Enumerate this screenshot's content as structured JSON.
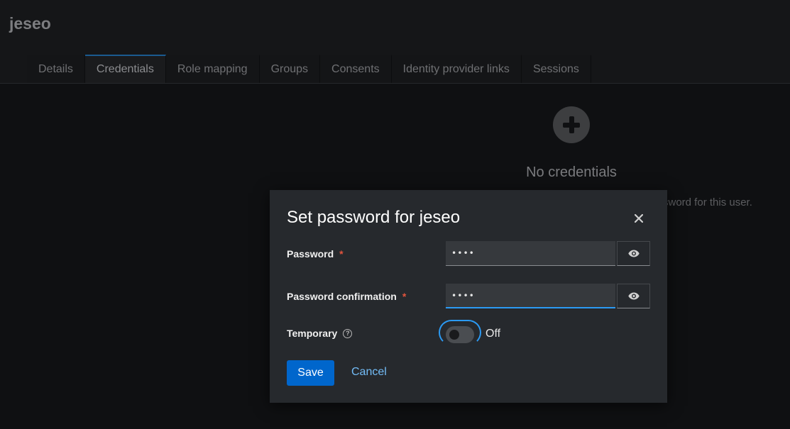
{
  "page": {
    "title": "jeseo",
    "tabs": [
      {
        "label": "Details"
      },
      {
        "label": "Credentials"
      },
      {
        "label": "Role mapping"
      },
      {
        "label": "Groups"
      },
      {
        "label": "Consents"
      },
      {
        "label": "Identity provider links"
      },
      {
        "label": "Sessions"
      }
    ],
    "active_tab": "Credentials",
    "empty_state": {
      "icon": "plus-circle-icon",
      "title": "No credentials",
      "body_fragment": "sword for this user."
    }
  },
  "modal": {
    "title": "Set password for jeseo",
    "close_icon": "close-icon",
    "password": {
      "label": "Password",
      "required_mark": "*",
      "value": "••••",
      "toggle_icon": "eye-icon"
    },
    "confirmation": {
      "label": "Password confirmation",
      "required_mark": "*",
      "value": "••••",
      "toggle_icon": "eye-icon"
    },
    "temporary": {
      "label": "Temporary",
      "help_icon": "question-circle-icon",
      "state_label": "Off",
      "on": false
    },
    "save_label": "Save",
    "cancel_label": "Cancel"
  },
  "colors": {
    "primary": "#0066cc",
    "link": "#73bcf7",
    "focus": "#2b9af3",
    "required": "#e2543d",
    "modal_bg": "#26292d"
  }
}
